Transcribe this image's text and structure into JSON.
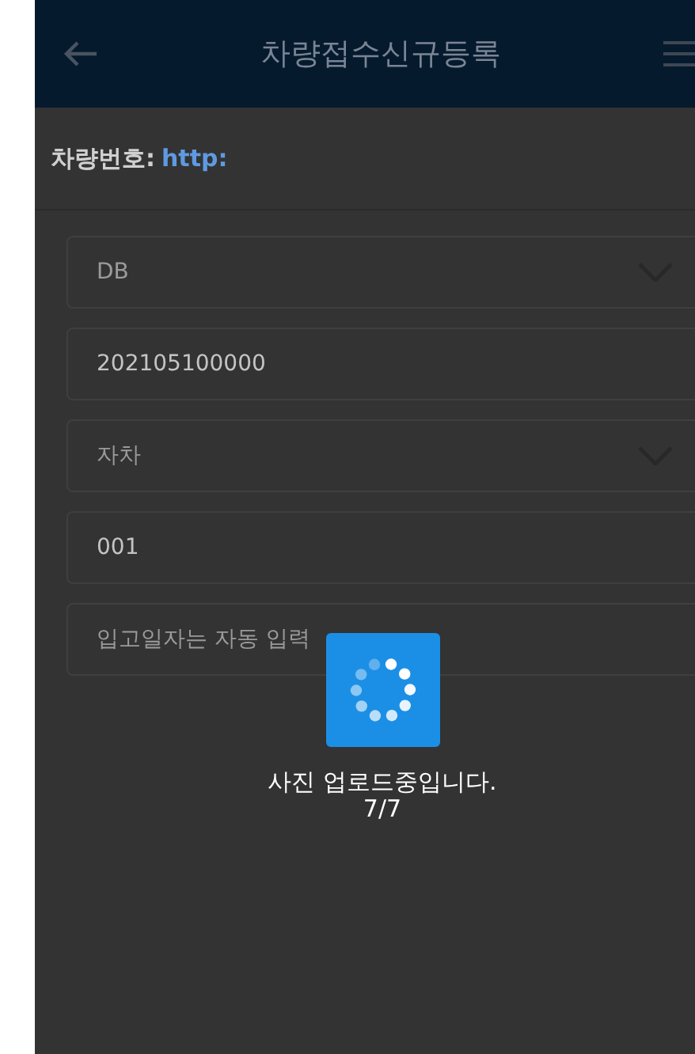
{
  "header": {
    "title": "차량접수신규등록"
  },
  "vehicle_number": {
    "label": "차량번호:",
    "value": "http:"
  },
  "fields": [
    {
      "kind": "select",
      "value": "DB"
    },
    {
      "kind": "input",
      "value": "202105100000"
    },
    {
      "kind": "select",
      "value": "자차"
    },
    {
      "kind": "input",
      "value": "001"
    },
    {
      "kind": "input",
      "placeholder": "입고일자는 자동 입력"
    }
  ],
  "loading": {
    "message": "사진 업로드중입니다.",
    "progress": "7/7"
  }
}
